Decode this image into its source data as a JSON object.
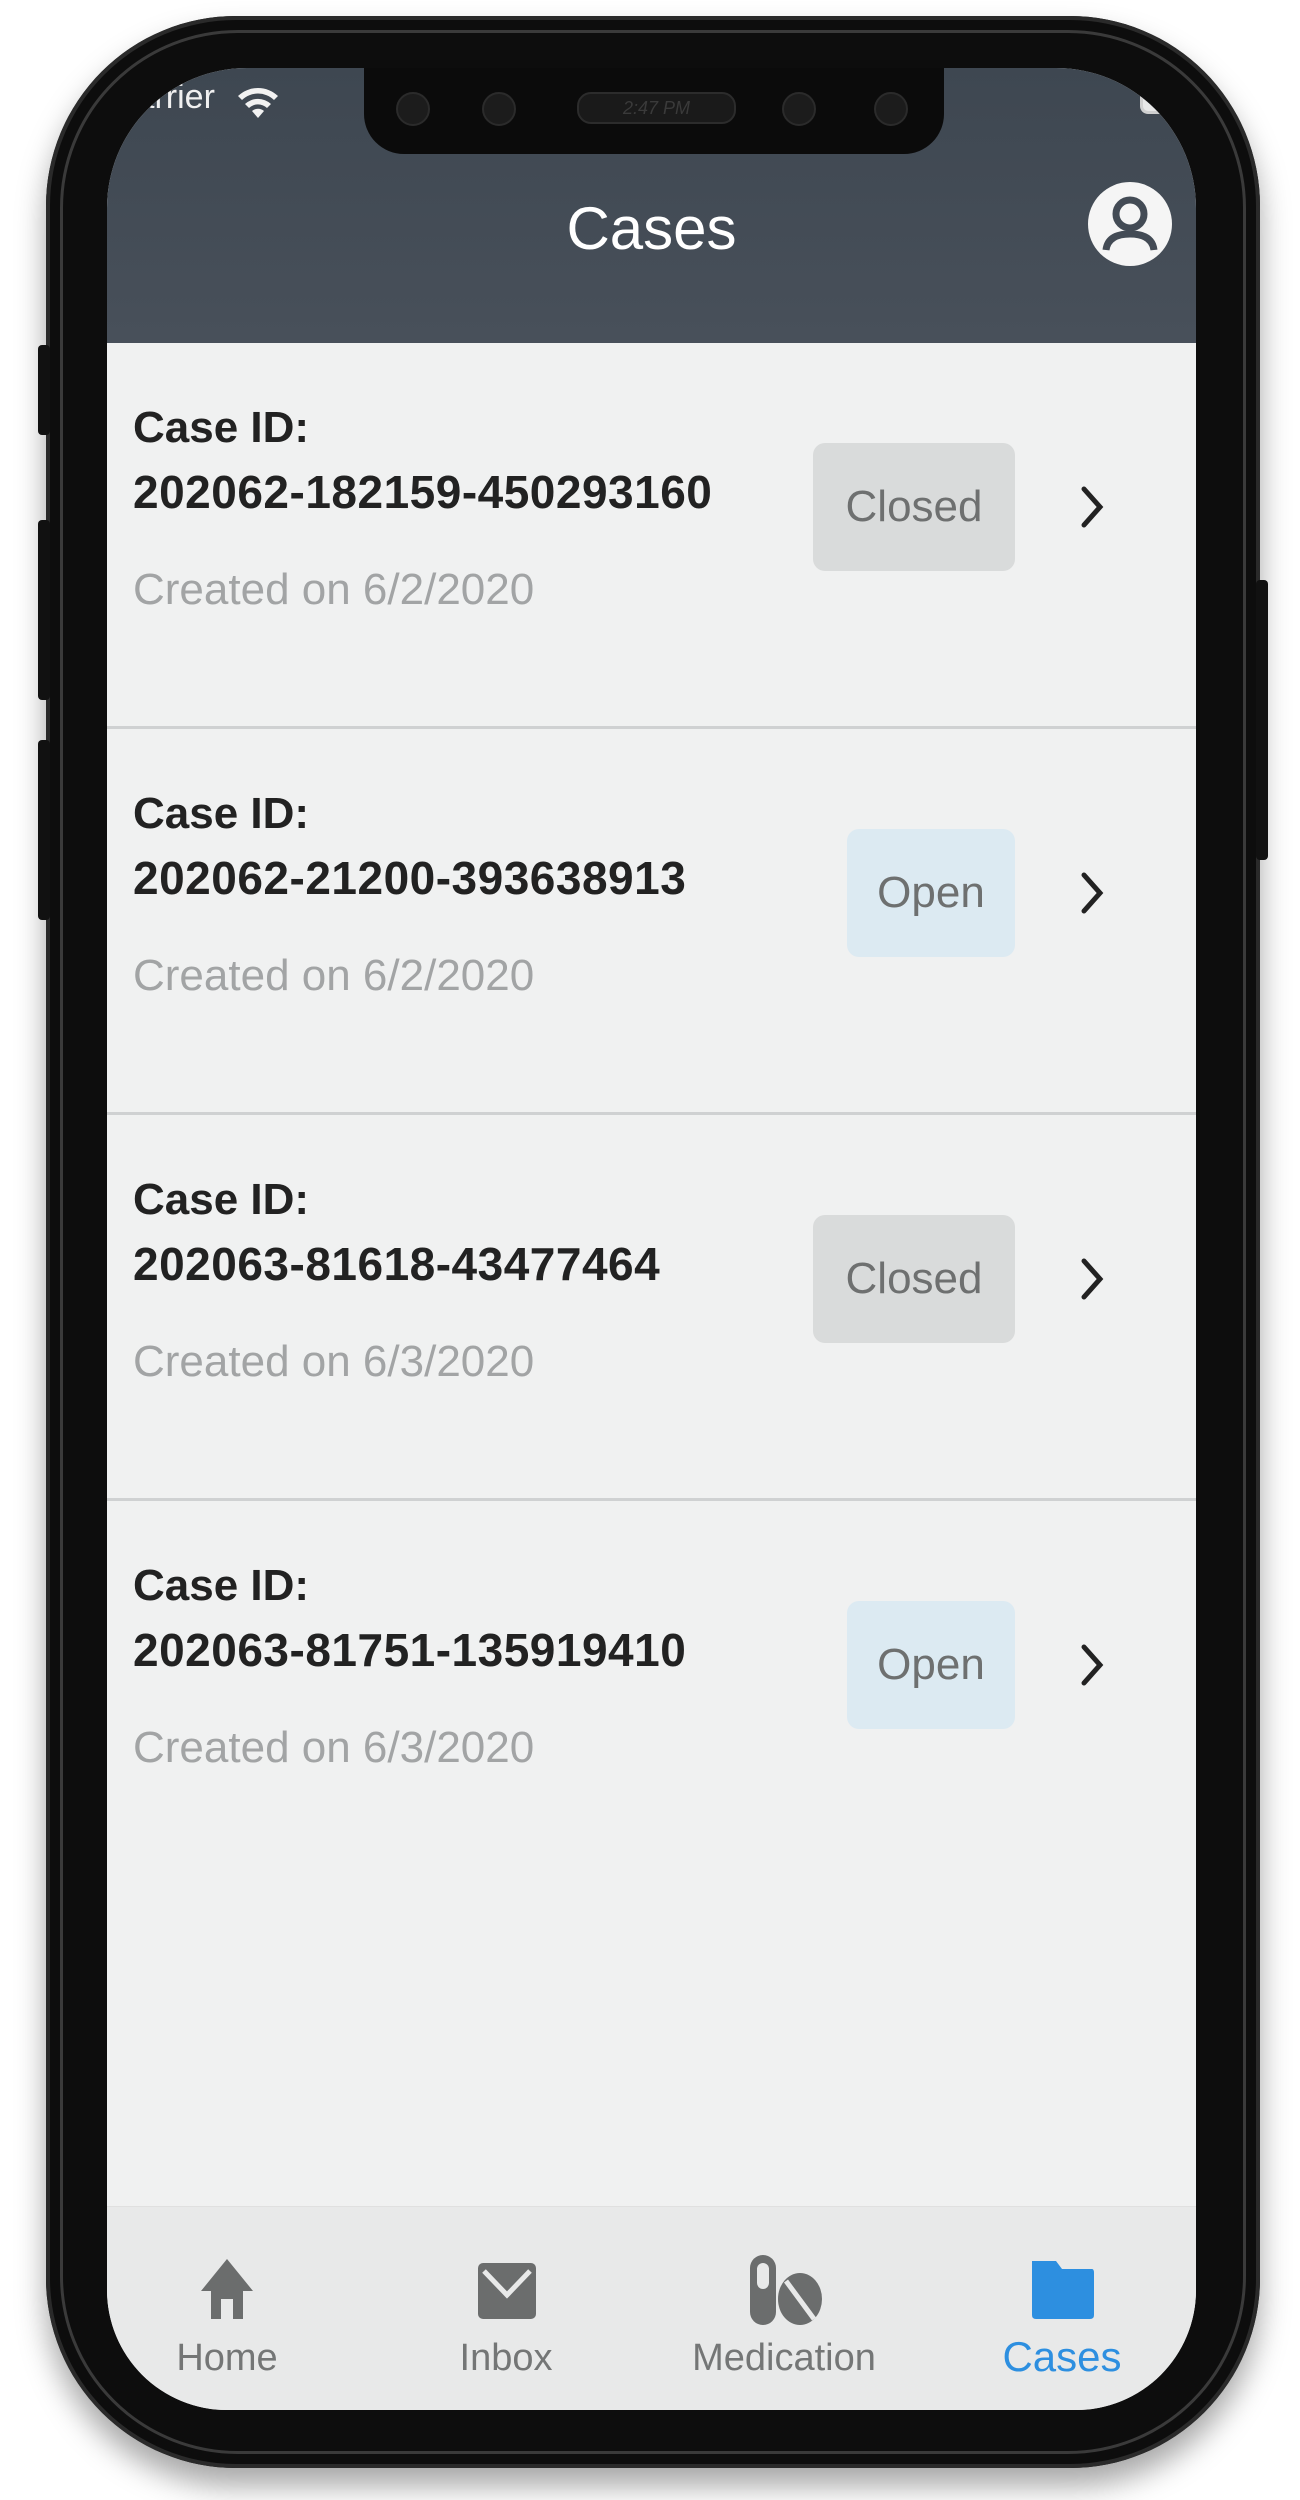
{
  "status_bar": {
    "carrier": "Carrier",
    "time": "2:47 PM"
  },
  "header": {
    "title": "Cases",
    "profile_icon": "user-circle-icon"
  },
  "cases": [
    {
      "label": "Case ID:",
      "id": "202062-182159-450293160",
      "created": "Created on 6/2/2020",
      "status": "Closed"
    },
    {
      "label": "Case ID:",
      "id": "202062-21200-393638913",
      "created": "Created on 6/2/2020",
      "status": "Open"
    },
    {
      "label": "Case ID:",
      "id": "202063-81618-43477464",
      "created": "Created on 6/3/2020",
      "status": "Closed"
    },
    {
      "label": "Case ID:",
      "id": "202063-81751-135919410",
      "created": "Created on 6/3/2020",
      "status": "Open"
    }
  ],
  "tabbar": {
    "items": [
      {
        "label": "Home",
        "icon": "home-icon",
        "active": false
      },
      {
        "label": "Inbox",
        "icon": "envelope-icon",
        "active": false
      },
      {
        "label": "Medication",
        "icon": "pills-icon",
        "active": false
      },
      {
        "label": "Cases",
        "icon": "folder-icon",
        "active": true
      }
    ]
  },
  "colors": {
    "header_bg": "#434b55",
    "active_tab": "#2d8fe0",
    "inactive_tab": "#747676",
    "badge_closed_bg": "#d9dbdb",
    "badge_open_bg": "#dceaf2"
  }
}
